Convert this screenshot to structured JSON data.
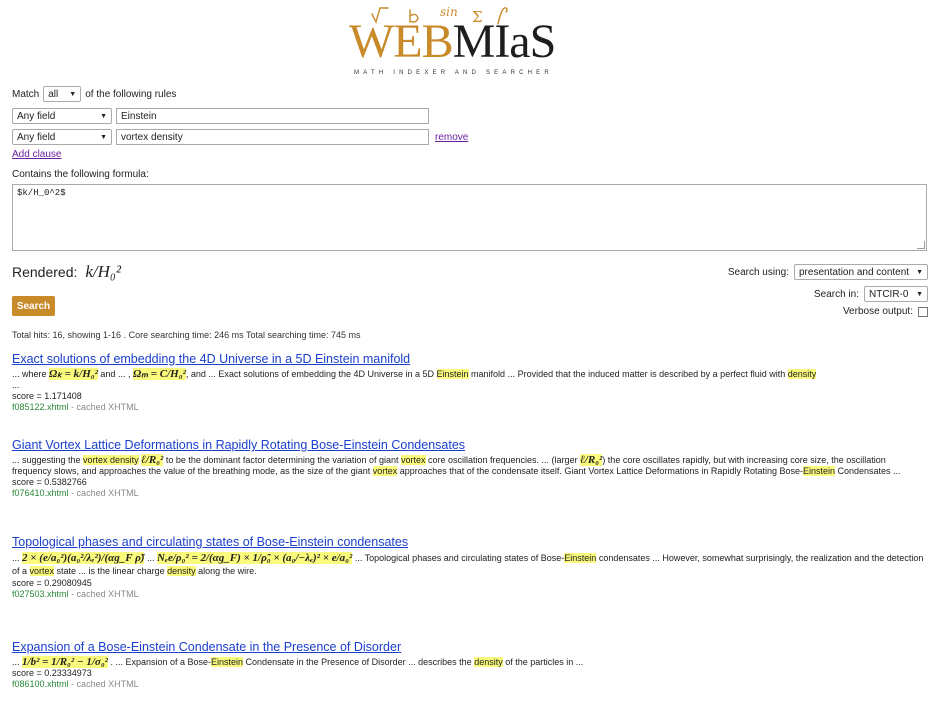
{
  "logo": {
    "symbols": "√  b  sin  Σ  ∫",
    "title_web": "WEB",
    "title_mias": "MIaS",
    "subtitle": "MATH INDEXER AND SEARCHER"
  },
  "form": {
    "match_prefix": "Match",
    "match_value": "all",
    "match_suffix": "of the following rules",
    "clauses": [
      {
        "field": "Any field",
        "value": "Einstein"
      },
      {
        "field": "Any field",
        "value": "vortex density",
        "remove": "remove"
      }
    ],
    "add_clause": "Add clause",
    "formula_label": "Contains the following formula:",
    "formula_value": "$k/H_0^2$",
    "rendered_label": "Rendered:",
    "rendered_formula": "k/H₀²",
    "search_using_label": "Search using:",
    "search_using_value": "presentation and content",
    "search_in_label": "Search in:",
    "search_in_value": "NTCIR-0",
    "verbose_label": "Verbose output:",
    "search_button": "Search"
  },
  "totals": "Total hits: 16, showing 1-16 . Core searching time: 246 ms Total searching time: 745 ms",
  "results": [
    {
      "title": "Exact solutions of embedding the 4D Universe in a 5D Einstein manifold",
      "snippet": {
        "a": "... where ",
        "m1": "Ωₖ = k/H₀²",
        "b": " and ... , ",
        "m2": "Ωₘ = C/H₀²",
        "c": ", and ... Exact solutions of embedding the 4D Universe in a 5D ",
        "h1": "Einstein",
        "d": " manifold ... Provided that the induced matter is described by a perfect fluid with ",
        "h2": "density",
        "e": "..."
      },
      "score": "score = 1.171408",
      "file": "f085122.xhtml",
      "cached": "- cached XHTML"
    },
    {
      "title": "Giant Vortex Lattice Deformations in Rapidly Rotating Bose-Einstein Condensates",
      "snippet": {
        "a": "... suggesting the ",
        "h1": "vortex density",
        "m1": "ℓ/R₀²",
        "b": " to be the dominant factor determining the variation of giant ",
        "h2": "vortex",
        "c": " core oscillation frequencies. ... (larger ",
        "m2": "ℓ/R₀²",
        "d": ") the core oscillates rapidly, but with increasing core size, the oscillation frequency slows, and approaches the value of the breathing mode, as the size of the giant ",
        "h3": "vortex",
        "e": " approaches that of the condensate itself. Giant Vortex Lattice Deformations in Rapidly Rotating Bose-",
        "h4": "Einstein",
        "f": " Condensates ..."
      },
      "score": "score = 0.5382766",
      "file": "f076410.xhtml",
      "cached": "- cached XHTML"
    },
    {
      "title": "Topological phases and circulating states of Bose-Einstein condensates",
      "snippet": {
        "a": "... ",
        "m1": "2 × (e/a₀²)(a₀²/λₑ²)/(αg_F ρ̃)",
        "b": " ... ",
        "m2": "Nₑe/ρ₀² = 2/(αg_F) × 1/ρ̃₀ × (a₀/−λₑ)² × e/a₀²",
        "c": " ... Topological phases and circulating states of Bose-",
        "h1": "Einstein",
        "d": " condensates ... However, somewhat surprisingly, the realization and the detection of a ",
        "h2": "vortex",
        "e": " state ... is the linear charge ",
        "h3": "density",
        "f": " along the wire."
      },
      "score": "score = 0.29080945",
      "file": "f027503.xhtml",
      "cached": "- cached XHTML"
    },
    {
      "title": "Expansion of a Bose-Einstein Condensate in the Presence of Disorder",
      "snippet": {
        "a": "... ",
        "m1": "1/b² = 1/R₀² − 1/σ₀²",
        "b": " . ... Expansion of a Bose-",
        "h1": "Einstein",
        "c": " Condensate in the Presence of Disorder ... describes the ",
        "h2": "density",
        "d": " of the particles in ..."
      },
      "score": "score = 0.23334973",
      "file": "f086100.xhtml",
      "cached": "- cached XHTML"
    }
  ],
  "colors": {
    "brand": "#c98a2a",
    "link": "#1a3fcc",
    "visited": "#6c1fa0",
    "file": "#2a8a3a",
    "highlight": "#fafa7c"
  }
}
